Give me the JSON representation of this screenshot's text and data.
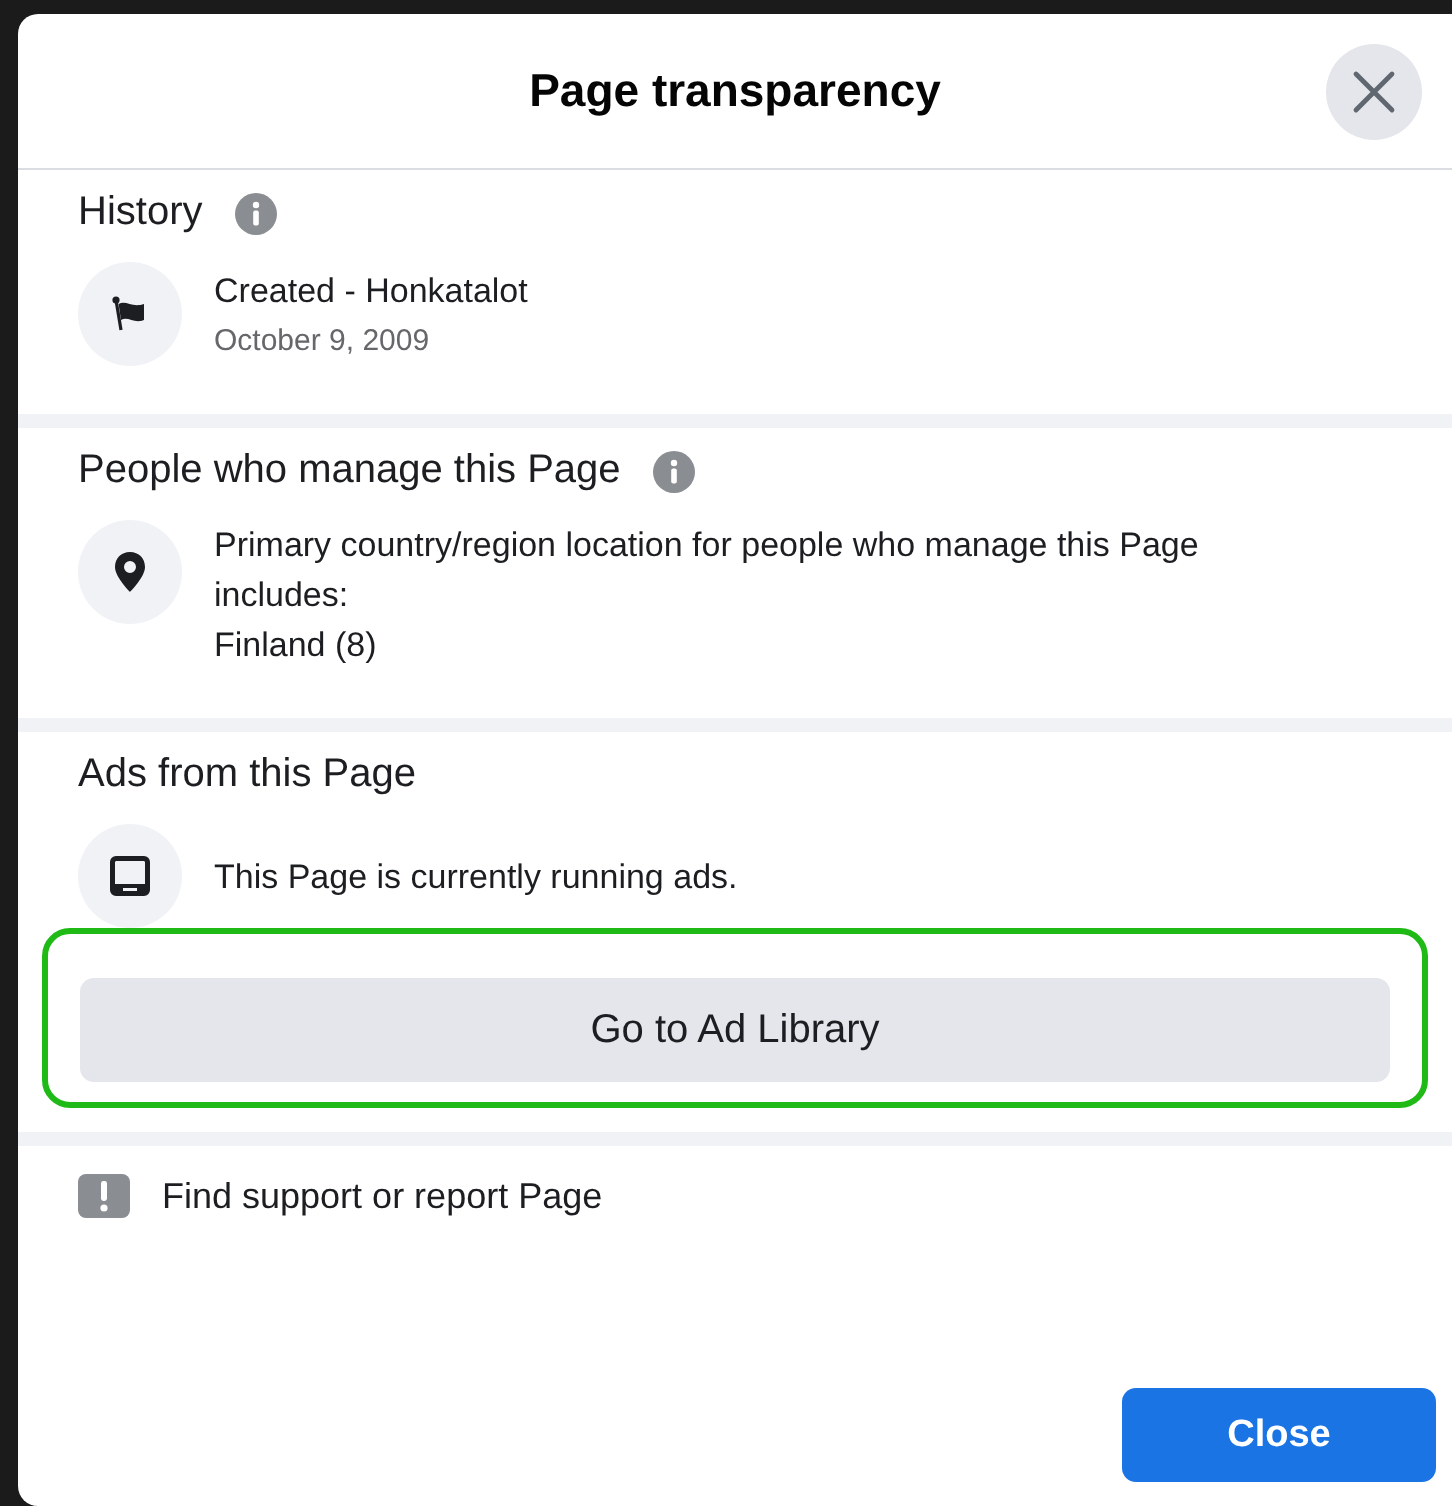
{
  "dialog": {
    "title": "Page transparency"
  },
  "sections": [
    {
      "title": "History",
      "info": true,
      "items": [
        {
          "kind": "flag",
          "lines": [
            {
              "text": "Created - Honkatalot",
              "kind": "primary"
            },
            {
              "text": "October 9, 2009",
              "kind": "secondary"
            }
          ]
        }
      ]
    },
    {
      "title": "People who manage this Page",
      "info": true,
      "items": [
        {
          "kind": "pin",
          "lines": [
            {
              "text": "Primary country/region location for people who manage this Page includes:",
              "kind": "primary"
            },
            {
              "text": "Finland (8)",
              "kind": "primary"
            }
          ]
        }
      ]
    },
    {
      "title": "Ads from this Page",
      "info": false,
      "items": [
        {
          "kind": "tablet",
          "lines": [
            {
              "text": "This Page is currently running ads.",
              "kind": "primary"
            }
          ]
        }
      ],
      "button": {
        "label": "Go to Ad Library",
        "highlighted": true
      }
    }
  ],
  "support": {
    "label": "Find support or report Page"
  },
  "footer": {
    "button": "Close"
  }
}
